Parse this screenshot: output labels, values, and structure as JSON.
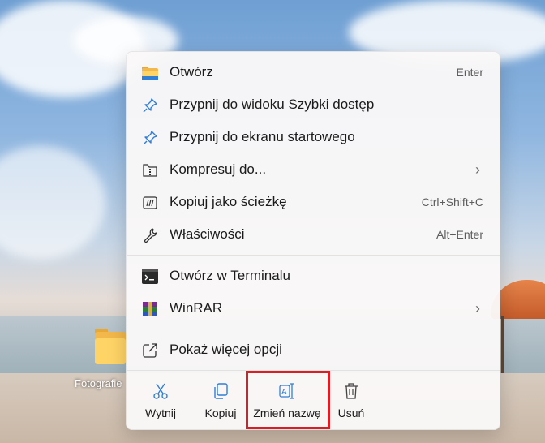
{
  "desktop": {
    "folder_label": "Fotografie"
  },
  "menu": {
    "items": [
      {
        "label": "Otwórz",
        "shortcut": "Enter",
        "icon": "folder-icon"
      },
      {
        "label": "Przypnij do widoku Szybki dostęp",
        "shortcut": "",
        "icon": "pin-icon"
      },
      {
        "label": "Przypnij do ekranu startowego",
        "shortcut": "",
        "icon": "pin-icon"
      },
      {
        "label": "Kompresuj do...",
        "shortcut": "",
        "icon": "zip-folder-icon"
      },
      {
        "label": "Kopiuj jako ścieżkę",
        "shortcut": "Ctrl+Shift+C",
        "icon": "copy-path-icon"
      },
      {
        "label": "Właściwości",
        "shortcut": "Alt+Enter",
        "icon": "wrench-icon"
      },
      {
        "label": "Otwórz w Terminalu",
        "shortcut": "",
        "icon": "terminal-icon"
      },
      {
        "label": "WinRAR",
        "shortcut": "",
        "icon": "winrar-icon"
      },
      {
        "label": "Pokaż więcej opcji",
        "shortcut": "",
        "icon": "open-external-icon"
      }
    ],
    "actions": [
      {
        "label": "Wytnij",
        "icon": "scissors-icon"
      },
      {
        "label": "Kopiuj",
        "icon": "copy-icon"
      },
      {
        "label": "Zmień nazwę",
        "icon": "rename-icon"
      },
      {
        "label": "Usuń",
        "icon": "trash-icon"
      }
    ],
    "highlight_color": "#d81f26"
  }
}
